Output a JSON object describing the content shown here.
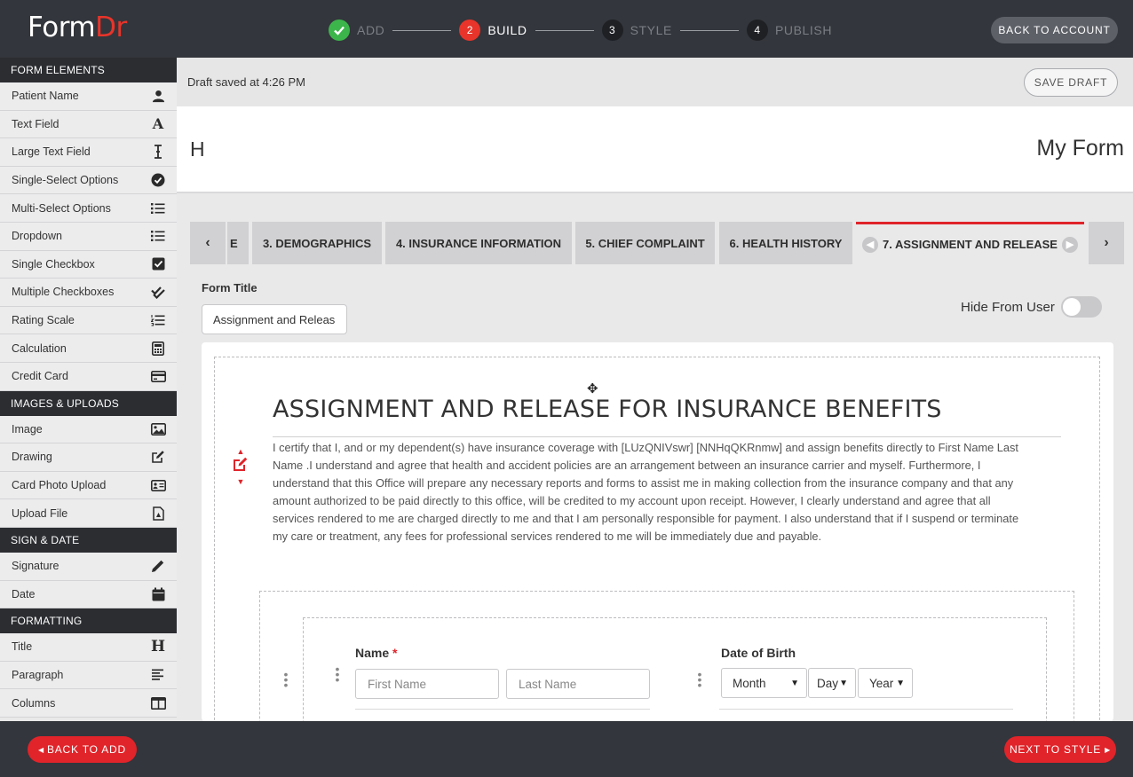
{
  "app": {
    "logo_form": "Form",
    "logo_dr": "Dr"
  },
  "steps": [
    {
      "num": "✓",
      "label": "ADD"
    },
    {
      "num": "2",
      "label": "BUILD"
    },
    {
      "num": "3",
      "label": "STYLE"
    },
    {
      "num": "4",
      "label": "PUBLISH"
    }
  ],
  "header": {
    "back_to_account": "BACK TO ACCOUNT"
  },
  "sidebar": {
    "form_elements": {
      "title": "FORM ELEMENTS",
      "items": [
        {
          "label": "Patient Name",
          "icon": "person-icon"
        },
        {
          "label": "Text Field",
          "icon": "letter-a-icon"
        },
        {
          "label": "Large Text Field",
          "icon": "text-cursor-icon"
        },
        {
          "label": "Single-Select Options",
          "icon": "check-circle-icon"
        },
        {
          "label": "Multi-Select Options",
          "icon": "list-icon"
        },
        {
          "label": "Dropdown",
          "icon": "list-icon"
        },
        {
          "label": "Single Checkbox",
          "icon": "checkbox-icon"
        },
        {
          "label": "Multiple Checkboxes",
          "icon": "double-check-icon"
        },
        {
          "label": "Rating Scale",
          "icon": "numbered-list-icon"
        },
        {
          "label": "Calculation",
          "icon": "calculator-icon"
        },
        {
          "label": "Credit Card",
          "icon": "credit-card-icon"
        }
      ]
    },
    "images_uploads": {
      "title": "IMAGES & UPLOADS",
      "items": [
        {
          "label": "Image",
          "icon": "image-icon"
        },
        {
          "label": "Drawing",
          "icon": "edit-square-icon"
        },
        {
          "label": "Card Photo Upload",
          "icon": "id-card-icon"
        },
        {
          "label": "Upload File",
          "icon": "file-icon"
        }
      ]
    },
    "sign_date": {
      "title": "SIGN & DATE",
      "items": [
        {
          "label": "Signature",
          "icon": "pencil-icon"
        },
        {
          "label": "Date",
          "icon": "calendar-icon"
        }
      ]
    },
    "formatting": {
      "title": "FORMATTING",
      "items": [
        {
          "label": "Title",
          "icon": "heading-icon"
        },
        {
          "label": "Paragraph",
          "icon": "align-left-icon"
        },
        {
          "label": "Columns",
          "icon": "columns-icon"
        }
      ]
    }
  },
  "draft": {
    "status": "Draft saved at 4:26 PM",
    "save_label": "SAVE DRAFT"
  },
  "title_area": {
    "left": "H",
    "right": "My Form"
  },
  "tabs": [
    {
      "label": "E"
    },
    {
      "label": "3. DEMOGRAPHICS"
    },
    {
      "label": "4. INSURANCE INFORMATION"
    },
    {
      "label": "5. CHIEF COMPLAINT"
    },
    {
      "label": "6. HEALTH HISTORY"
    },
    {
      "label": "7. ASSIGNMENT AND RELEASE"
    }
  ],
  "form": {
    "title_label": "Form Title",
    "title_value": "Assignment and Releas",
    "hide_label": "Hide From User",
    "hide_on": false
  },
  "content": {
    "heading": "ASSIGNMENT AND RELEASE FOR INSURANCE BENEFITS",
    "lines": [
      "I certify that I, and or my dependent(s) have insurance coverage with [LUzQNIVswr] [NNHqQKRnmw] and assign benefits directly to First Name Last",
      "Name .I understand and agree that health and accident policies are an arrangement between an insurance carrier and myself. Furthermore, I",
      "understand that this Office will prepare any necessary reports and forms to assist me in making collection from the insurance company and that any",
      "amount authorized to be paid directly to this office, will be credited to my account upon receipt. However, I clearly understand and agree that all",
      "services rendered to me are charged directly to me and that I am personally responsible for payment. I also understand that if I suspend or terminate",
      "my care or treatment, any fees for professional services rendered to me will be immediately due and payable."
    ]
  },
  "fields": {
    "name": {
      "label": "Name",
      "required": "*",
      "first_placeholder": "First Name",
      "last_placeholder": "Last Name"
    },
    "dob": {
      "label": "Date of Birth",
      "month": "Month",
      "day": "Day",
      "year": "Year"
    }
  },
  "footer": {
    "back_label": "BACK TO ADD",
    "next_label": "NEXT TO STYLE"
  },
  "colors": {
    "accent": "#e0242a",
    "success": "#3cb54a",
    "dark": "#33363c"
  }
}
